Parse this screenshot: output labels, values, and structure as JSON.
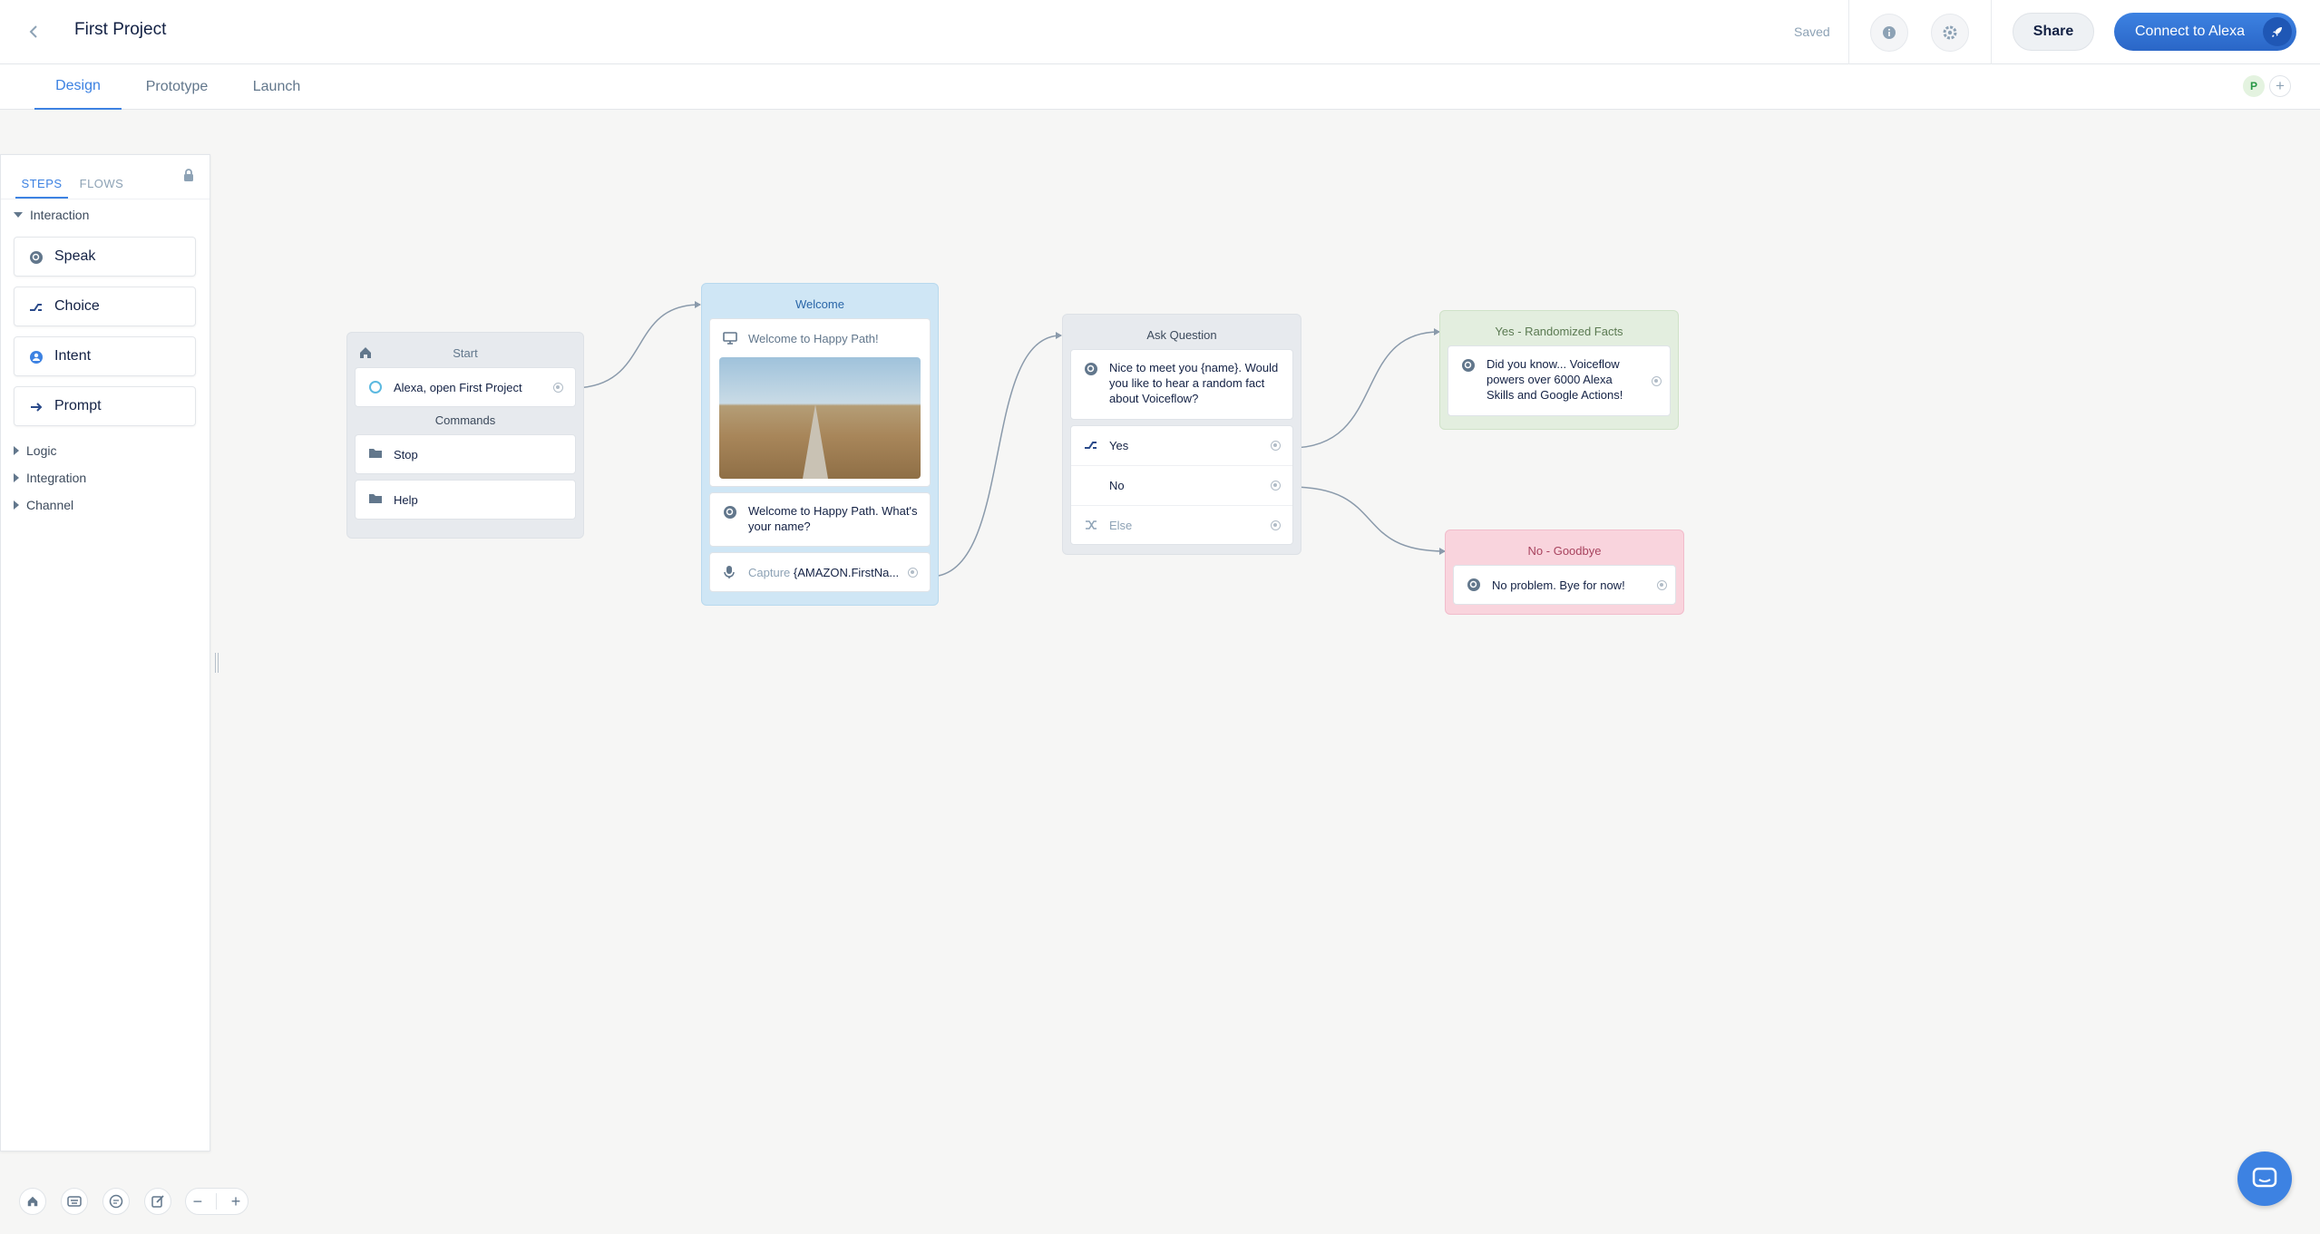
{
  "header": {
    "title": "First Project",
    "status": "Saved",
    "share_label": "Share",
    "connect_label": "Connect to Alexa"
  },
  "tabs": [
    {
      "label": "Design",
      "active": true
    },
    {
      "label": "Prototype",
      "active": false
    },
    {
      "label": "Launch",
      "active": false
    }
  ],
  "collaborators": [
    {
      "initial": "P"
    }
  ],
  "panel": {
    "tabs": [
      {
        "label": "STEPS",
        "active": true
      },
      {
        "label": "FLOWS",
        "active": false
      }
    ],
    "sections": {
      "interaction": "Interaction",
      "logic": "Logic",
      "integration": "Integration",
      "channel": "Channel"
    },
    "items": [
      {
        "label": "Speak",
        "icon": "speak-icon"
      },
      {
        "label": "Choice",
        "icon": "choice-icon"
      },
      {
        "label": "Intent",
        "icon": "intent-icon"
      },
      {
        "label": "Prompt",
        "icon": "prompt-arrow-icon"
      }
    ]
  },
  "canvas": {
    "start": {
      "title": "Start",
      "launch": "Alexa, open First Project",
      "commands_title": "Commands",
      "commands": [
        "Stop",
        "Help"
      ]
    },
    "welcome": {
      "title": "Welcome",
      "visual": "Welcome to Happy Path!",
      "speak": "Welcome to Happy Path. What's your name?",
      "capture_label": "Capture",
      "capture_value": "{AMAZON.FirstNa..."
    },
    "ask": {
      "title": "Ask Question",
      "speak": "Nice to meet you {name}. Would you like to hear a random fact about Voiceflow?",
      "choices": [
        "Yes",
        "No",
        "Else"
      ]
    },
    "yes": {
      "title": "Yes - Randomized Facts",
      "speak": "Did you know... Voiceflow powers over 6000 Alexa Skills and Google Actions!"
    },
    "no": {
      "title": "No - Goodbye",
      "speak": "No problem. Bye for now!"
    }
  },
  "colors": {
    "accent": "#3d82e2",
    "welcome_block": "#cfe6f5",
    "yes_block": "#e3eedf",
    "no_block": "#f9d4dd"
  }
}
